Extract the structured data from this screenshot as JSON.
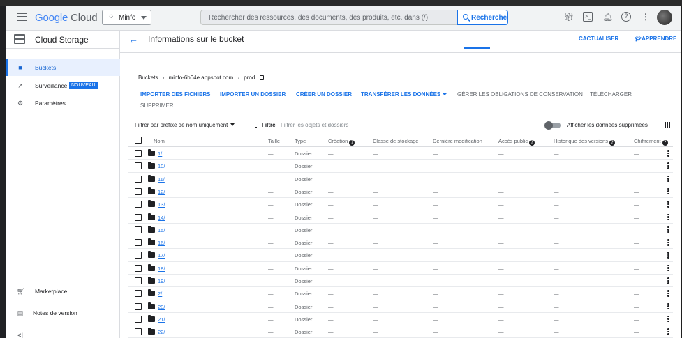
{
  "header": {
    "logo_google": "Google",
    "logo_cloud": "Cloud",
    "project_name": "Minfo",
    "search_placeholder": "Rechercher des ressources, des documents, des produits, etc. dans (/)",
    "search_button": "Recherche",
    "icons": [
      "gift-icon",
      "terminal-icon",
      "bell-icon",
      "help-icon",
      "more-vert-icon"
    ]
  },
  "sidebar": {
    "product": "Cloud Storage",
    "items": [
      {
        "label": "Buckets",
        "icon": "bucket-icon",
        "active": true
      },
      {
        "label": "Surveillance",
        "icon": "chart-icon",
        "badge": "NOUVEAU"
      },
      {
        "label": "Paramètres",
        "icon": "gear-icon"
      }
    ],
    "bottom_items": [
      {
        "label": "Marketplace",
        "icon": "marketplace-icon"
      },
      {
        "label": "Notes de version",
        "icon": "notes-icon"
      }
    ],
    "collapse": "<|"
  },
  "main": {
    "title": "Informations sur le bucket",
    "refresh_label": "ACTUALISER",
    "learn_label": "APPRENDRE",
    "breadcrumb": {
      "root": "Buckets",
      "bucket": "minfo-6b04e.appspot.com",
      "folder": "prod"
    },
    "actions": [
      "IMPORTER DES FICHIERS",
      "IMPORTER UN DOSSIER",
      "CRÉER UN DOSSIER",
      "TRANSFÉRER LES DONNÉES",
      "GÉRER LES OBLIGATIONS DE CONSERVATION",
      "TÉLÉCHARGER",
      "SUPPRIMER"
    ],
    "filter": {
      "prefix_label": "Filtrer par préfixe de nom uniquement",
      "filter_label": "Filtre",
      "filter_placeholder": "Filtrer les objets et dossiers",
      "show_deleted": "Afficher les données supprimées"
    },
    "columns": [
      "Nom",
      "Taille",
      "Type",
      "Création",
      "Classe de stockage",
      "Dernière modification",
      "Accès public",
      "Historique des versions",
      "Chiffrement"
    ],
    "rows": [
      {
        "name": "1/",
        "size": "—",
        "type": "Dossier",
        "created": "—",
        "class": "—",
        "modified": "—",
        "public": "—",
        "history": "—",
        "enc": "—"
      },
      {
        "name": "10/",
        "size": "—",
        "type": "Dossier",
        "created": "—",
        "class": "—",
        "modified": "—",
        "public": "—",
        "history": "—",
        "enc": "—"
      },
      {
        "name": "11/",
        "size": "—",
        "type": "Dossier",
        "created": "—",
        "class": "—",
        "modified": "—",
        "public": "—",
        "history": "—",
        "enc": "—"
      },
      {
        "name": "12/",
        "size": "—",
        "type": "Dossier",
        "created": "—",
        "class": "—",
        "modified": "—",
        "public": "—",
        "history": "—",
        "enc": "—"
      },
      {
        "name": "13/",
        "size": "—",
        "type": "Dossier",
        "created": "—",
        "class": "—",
        "modified": "—",
        "public": "—",
        "history": "—",
        "enc": "—"
      },
      {
        "name": "14/",
        "size": "—",
        "type": "Dossier",
        "created": "—",
        "class": "—",
        "modified": "—",
        "public": "—",
        "history": "—",
        "enc": "—"
      },
      {
        "name": "15/",
        "size": "—",
        "type": "Dossier",
        "created": "—",
        "class": "—",
        "modified": "—",
        "public": "—",
        "history": "—",
        "enc": "—"
      },
      {
        "name": "16/",
        "size": "—",
        "type": "Dossier",
        "created": "—",
        "class": "—",
        "modified": "—",
        "public": "—",
        "history": "—",
        "enc": "—"
      },
      {
        "name": "17/",
        "size": "—",
        "type": "Dossier",
        "created": "—",
        "class": "—",
        "modified": "—",
        "public": "—",
        "history": "—",
        "enc": "—"
      },
      {
        "name": "18/",
        "size": "—",
        "type": "Dossier",
        "created": "—",
        "class": "—",
        "modified": "—",
        "public": "—",
        "history": "—",
        "enc": "—"
      },
      {
        "name": "19/",
        "size": "—",
        "type": "Dossier",
        "created": "—",
        "class": "—",
        "modified": "—",
        "public": "—",
        "history": "—",
        "enc": "—"
      },
      {
        "name": "2/",
        "size": "—",
        "type": "Dossier",
        "created": "—",
        "class": "—",
        "modified": "—",
        "public": "—",
        "history": "—",
        "enc": "—"
      },
      {
        "name": "20/",
        "size": "—",
        "type": "Dossier",
        "created": "—",
        "class": "—",
        "modified": "—",
        "public": "—",
        "history": "—",
        "enc": "—"
      },
      {
        "name": "21/",
        "size": "—",
        "type": "Dossier",
        "created": "—",
        "class": "—",
        "modified": "—",
        "public": "—",
        "history": "—",
        "enc": "—"
      },
      {
        "name": "22/",
        "size": "—",
        "type": "Dossier",
        "created": "—",
        "class": "—",
        "modified": "—",
        "public": "—",
        "history": "—",
        "enc": "—"
      }
    ]
  },
  "colors": {
    "accent": "#1a73e8",
    "active_bg": "#e8f0fe",
    "header_bg": "#f1f3f4"
  }
}
